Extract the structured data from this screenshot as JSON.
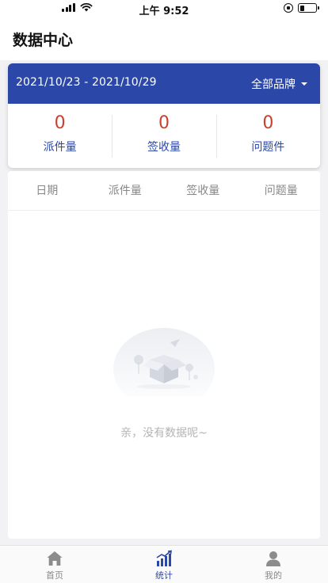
{
  "status_bar": {
    "time": "上午 9:52"
  },
  "header": {
    "title": "数据中心"
  },
  "filter": {
    "date_range": "2021/10/23 - 2021/10/29",
    "brand": "全部品牌"
  },
  "stats": [
    {
      "value": "0",
      "label": "派件量",
      "value_color": "#c8402e"
    },
    {
      "value": "0",
      "label": "签收量",
      "value_color": "#c8402e"
    },
    {
      "value": "0",
      "label": "问题件",
      "value_color": "#c8402e"
    }
  ],
  "table": {
    "columns": [
      "日期",
      "派件量",
      "签收量",
      "问题量"
    ]
  },
  "empty_state": {
    "message": "亲，没有数据呢~"
  },
  "tabbar": {
    "items": [
      {
        "label": "首页",
        "icon": "home-icon",
        "active": false
      },
      {
        "label": "统计",
        "icon": "stats-icon",
        "active": true
      },
      {
        "label": "我的",
        "icon": "user-icon",
        "active": false
      }
    ]
  },
  "colors": {
    "accent": "#2b47a8",
    "stat_value": "#c8402e"
  }
}
